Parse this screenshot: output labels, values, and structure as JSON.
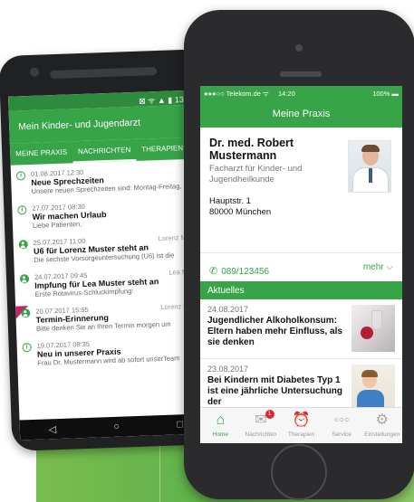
{
  "android": {
    "status_time": "13:26",
    "app_title": "Mein Kinder- und Jugendarzt",
    "tabs": [
      {
        "label": "MEINE PRAXIS"
      },
      {
        "label": "NACHRICHTEN"
      },
      {
        "label": "THERAPIEN"
      }
    ],
    "messages": [
      {
        "icon": "info-icon",
        "date": "01.08.2017 12:30",
        "sender": "",
        "title": "Neue Sprechzeiten",
        "text": "Unsere neuen Sprechzeiten sind: Montag-Freitag,"
      },
      {
        "icon": "info-icon",
        "date": "27.07.2017 08:30",
        "sender": "",
        "title": "Wir machen Urlaub",
        "text": "Liebe Patienten,"
      },
      {
        "icon": "person-icon",
        "date": "25.07.2017 11:00",
        "sender": "Lorenz Muster",
        "title": "U6 für Lorenz Muster steht an",
        "text": "Die sechste Vorsorgeuntersuchung (U6) ist die"
      },
      {
        "icon": "person-icon",
        "date": "24.07.2017 09:45",
        "sender": "Lea Muster",
        "title": "Impfung für Lea Muster steht an",
        "text": "Erste Rotavirus-Schluckimpfung:"
      },
      {
        "icon": "person-icon",
        "date": "20.07.2017 15:55",
        "sender": "Lorenz Muster",
        "title": "Termin-Erinnerung",
        "text": "Bitte denken Sie an Ihren Termin morgen um"
      },
      {
        "icon": "info-icon",
        "date": "19.07.2017 08:35",
        "sender": "",
        "title": "Neu in unserer Praxis",
        "text": "Frau Dr. Mustermann wird ab sofort unserTeam"
      }
    ],
    "nav": {
      "back": "◁",
      "home": "○",
      "recent": "□"
    }
  },
  "ios": {
    "status": {
      "carrier": "●●●○○ Telekom.de ᯤ",
      "time": "14:20",
      "battery": "100% ▬"
    },
    "nav_title": "Meine Praxis",
    "doctor": {
      "name": "Dr. med. Robert Mustermann",
      "role": "Facharzt für Kinder- und Jugendheilkunde",
      "street": "Hauptstr. 1",
      "city": "80000 München"
    },
    "phone": "089/123456",
    "more_label": "mehr",
    "section_title": "Aktuelles",
    "news": [
      {
        "date": "24.08.2017",
        "title": "Jugendlicher Alkoholkonsum: Eltern haben mehr Einfluss, als sie denken"
      },
      {
        "date": "23.08.2017",
        "title": "Bei Kindern mit Diabetes Typ 1 ist eine jährliche Untersuchung der"
      }
    ],
    "tabbar": [
      {
        "label": "Home",
        "icon": "home-icon",
        "active": true
      },
      {
        "label": "Nachrichten",
        "icon": "mail-icon",
        "badge": "1"
      },
      {
        "label": "Therapien",
        "icon": "alarm-clock-icon"
      },
      {
        "label": "Service",
        "icon": "dots-icon"
      },
      {
        "label": "Einstellungen",
        "icon": "gear-icon"
      }
    ]
  },
  "colors": {
    "brand_green": "#37a448",
    "dark_green": "#2e8b3d",
    "badge_red": "#e3262e"
  }
}
